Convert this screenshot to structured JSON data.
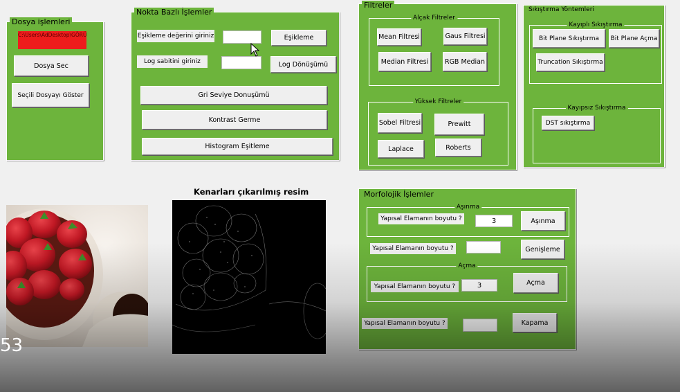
{
  "dosya": {
    "title": "Dosya işlemleri",
    "warning": "C:\\Users\\AdDesktop\\GÖRÜNTÜ",
    "select_button": "Dosya Sec",
    "show_button": "Seçili Dosyayı Göster"
  },
  "nokta": {
    "title": "Nokta Bazlı İşlemler",
    "threshold_label": "Eşikleme değerini giriniz",
    "threshold_value": "",
    "threshold_button": "Eşikleme",
    "log_label": "Log sabitini giriniz",
    "log_value": "",
    "log_button": "Log Dönüşümü",
    "gray_button": "Gri Seviye Donuşümü",
    "contrast_button": "Kontrast Germe",
    "histogram_button": "Histogram Eşitleme"
  },
  "filtreler": {
    "title": "Filtreler",
    "low_title": "Alçak Filtreler",
    "mean": "Mean Filtresi",
    "gaus": "Gaus Filtresi",
    "median": "Median Filtresi",
    "rgb_median": "RGB Median",
    "high_title": "Yüksek Filtreler",
    "sobel": "Sobel Filtresi",
    "prewitt": "Prewitt",
    "laplace": "Laplace",
    "roberts": "Roberts"
  },
  "sikistirma": {
    "title": "Sıkıştırma Yöntemleri",
    "lossy_title": "Kayıplı Sıkıştırma",
    "bit_plane_compress": "Bit Plane Sıkıştırma",
    "bit_plane_open": "Bit Plane Açma",
    "truncation": "Truncation  Sıkıştırma",
    "lossless_title": "Kayıpsız Sıkıştırma",
    "dst": "DST sıkıştırma"
  },
  "images": {
    "edge_title": "Kenarları çıkarılmış resim"
  },
  "morfolojik": {
    "title": "Morfolojik İşlemler",
    "erosion_title": "Aşınma",
    "erosion_label": "Yapısal Elamanın boyutu ?",
    "erosion_value": "3",
    "erosion_button": "Aşınma",
    "dilation_label": "Yapısal Elamanın boyutu ?",
    "dilation_value": "",
    "dilation_button": "Genişleme",
    "opening_title": "Açma",
    "opening_label": "Yapısal Elamanın boyutu ?",
    "opening_value": "3",
    "opening_button": "Açma",
    "closing_label": "Yapısal Elamanın boyutu ?",
    "closing_value": "",
    "closing_button": "Kapama"
  },
  "video": {
    "timecode": "53"
  },
  "colors": {
    "panel_green": "#6db43c",
    "warning_red": "#ee1c1c",
    "button_gray": "#efefef"
  }
}
